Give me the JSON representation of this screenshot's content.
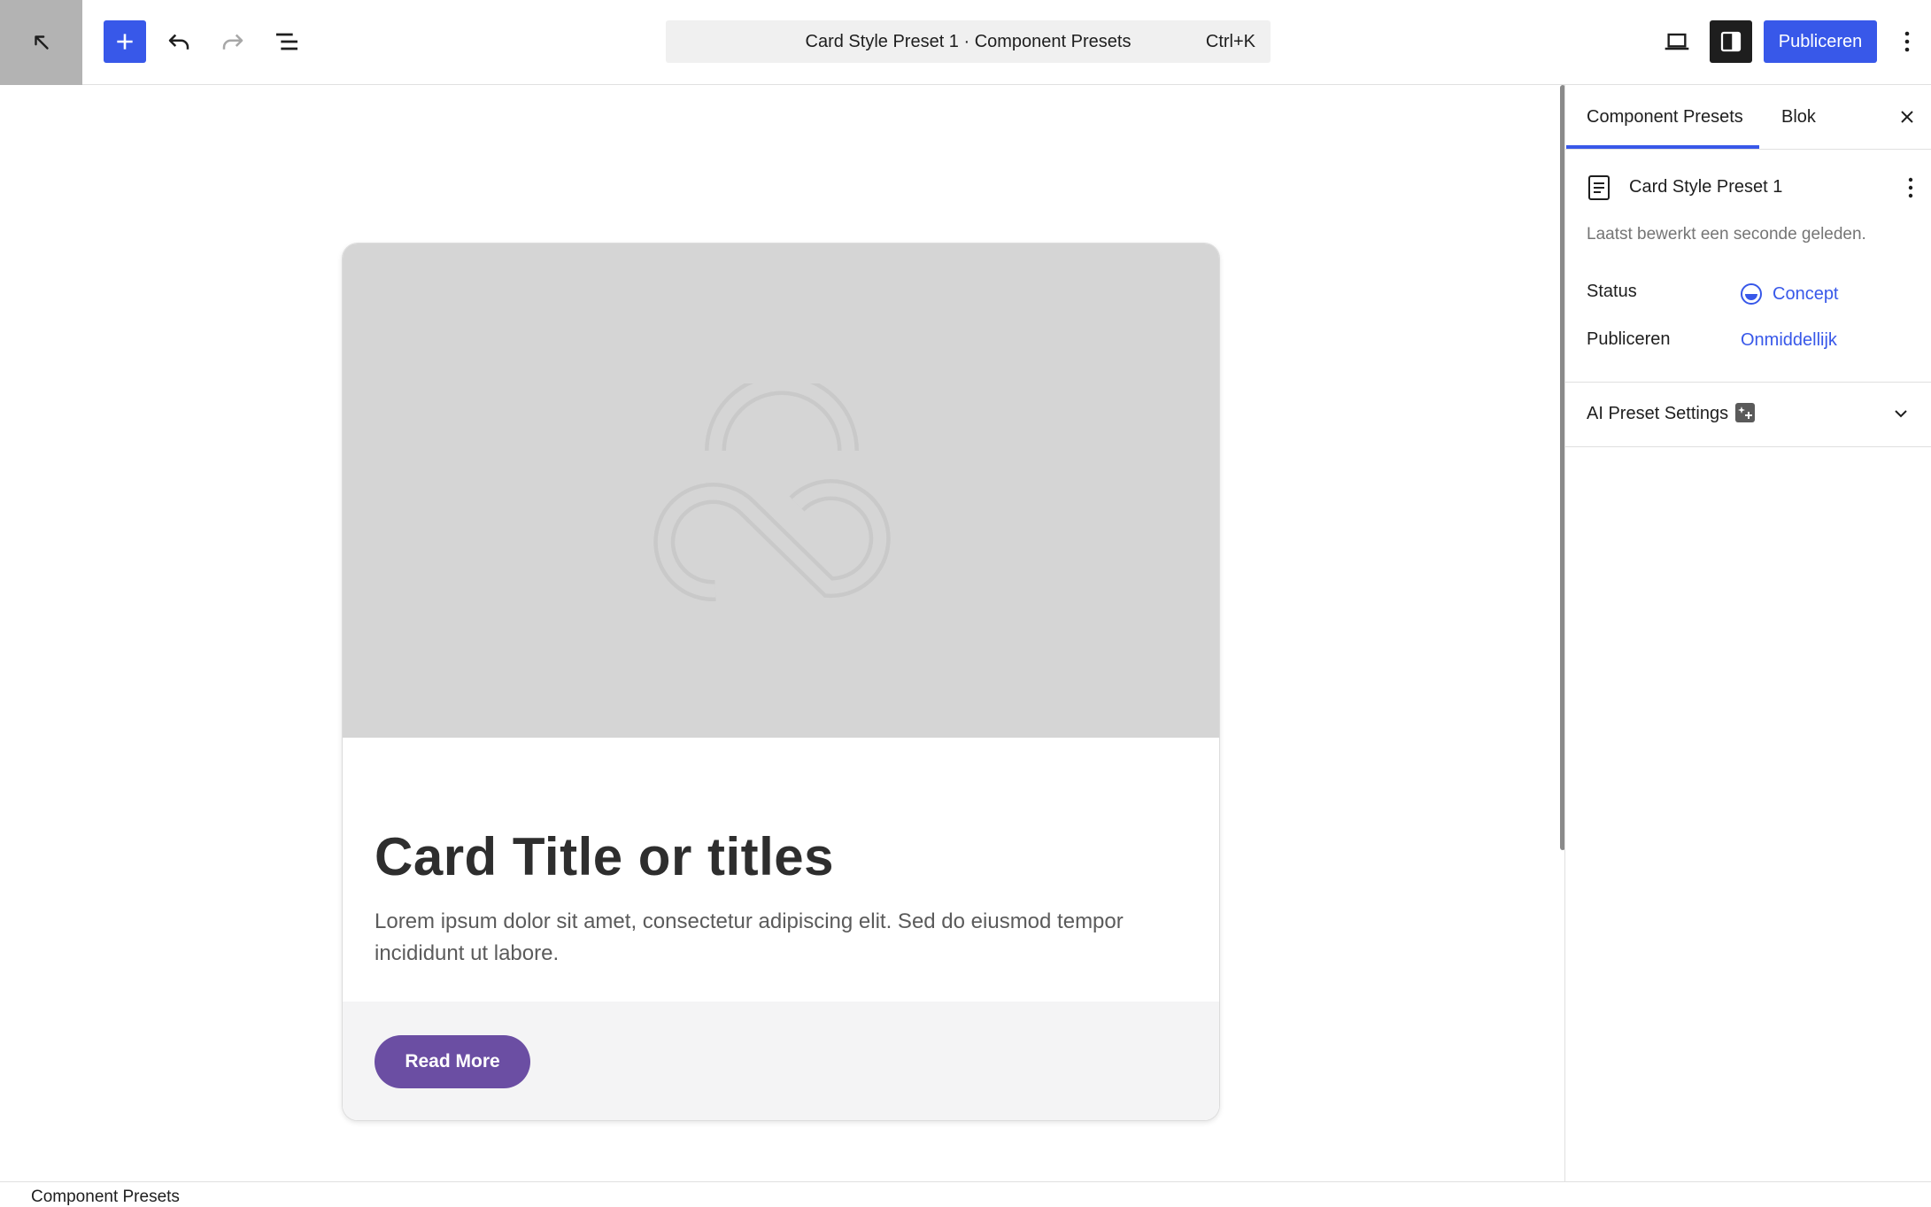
{
  "topbar": {
    "back_icon": "arrow-up-left-icon",
    "add_icon": "plus-icon",
    "undo_icon": "undo-icon",
    "redo_icon": "redo-icon",
    "listview_icon": "list-view-icon",
    "command_title": "Card Style Preset 1 · Component Presets",
    "command_shortcut": "Ctrl+K",
    "device_icon": "laptop-icon",
    "settings_icon": "sidebar-toggle-icon",
    "publish_label": "Publiceren",
    "more_icon": "vertical-dots-icon",
    "accent_color": "#3858e9"
  },
  "canvas": {
    "card": {
      "media_icon": "infinity-cloud-placeholder-icon",
      "title": "Card Title or titles",
      "text": "Lorem ipsum dolor sit amet, consectetur adipiscing elit. Sed do eiusmod tempor incididunt ut labore.",
      "button_label": "Read More",
      "button_color": "#6b4ea3"
    }
  },
  "sidebar": {
    "tabs": [
      {
        "label": "Component Presets",
        "active": true
      },
      {
        "label": "Blok",
        "active": false
      }
    ],
    "close_icon": "close-icon",
    "document": {
      "icon": "document-icon",
      "title": "Card Style Preset 1",
      "last_edited": "Laatst bewerkt een seconde geleden."
    },
    "meta": {
      "status_label": "Status",
      "status_value": "Concept",
      "publish_label": "Publiceren",
      "publish_value": "Onmiddellijk"
    },
    "ai_panel": {
      "title": "AI Preset Settings",
      "badge_icon": "ai-sparkle-icon",
      "chevron_icon": "chevron-down-icon"
    }
  },
  "footer": {
    "breadcrumb": "Component Presets"
  }
}
